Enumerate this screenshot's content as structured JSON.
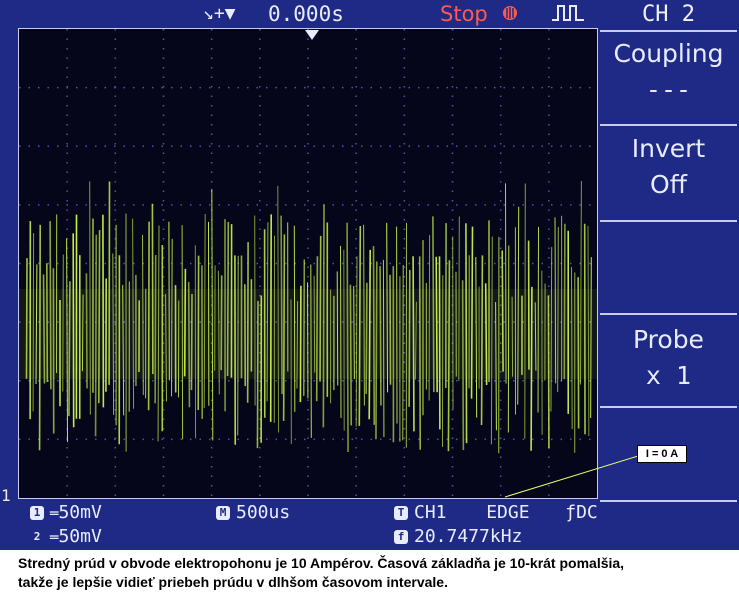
{
  "topbar": {
    "trigger_icons": "↘+▼",
    "time_offset": "0.000s",
    "run_state": "Stop",
    "trigger_slope_icon": "rising-edge-icon"
  },
  "menu": {
    "channel_title": "CH 2",
    "items": [
      {
        "label": "Coupling",
        "value": "---"
      },
      {
        "label": "Invert",
        "value": "Off"
      },
      {
        "label": "",
        "value": ""
      },
      {
        "label": "Probe",
        "value": "x 1"
      },
      {
        "label": "",
        "value": ""
      }
    ]
  },
  "bottombar": {
    "ch1_scale": "50mV",
    "ch2_scale": "50mV",
    "timebase": "500us",
    "trigger_source": "CH1",
    "trigger_type": "EDGE",
    "trigger_coupling": "DC",
    "frequency": "20.7477kHz",
    "ch1_badge": "1",
    "ch2_badge": "2",
    "time_badge": "M",
    "trigger_badge": "T",
    "freq_badge": "f"
  },
  "marker": {
    "ground_marker": "1"
  },
  "annotation": {
    "label": "I = 0 A"
  },
  "caption": {
    "line1": "Stredný prúd v obvode elektropohonu je 10 Ampérov. Časová základňa je 10-krát pomalšia,",
    "line2": "takže je lepšie vidieť priebeh prúdu v dlhšom časovom intervale."
  },
  "colors": {
    "trace": "#c8f04a",
    "screen_bg": "#05061a",
    "bezel_bg": "#1f2a86",
    "stop_red": "#ff5a4a"
  }
}
